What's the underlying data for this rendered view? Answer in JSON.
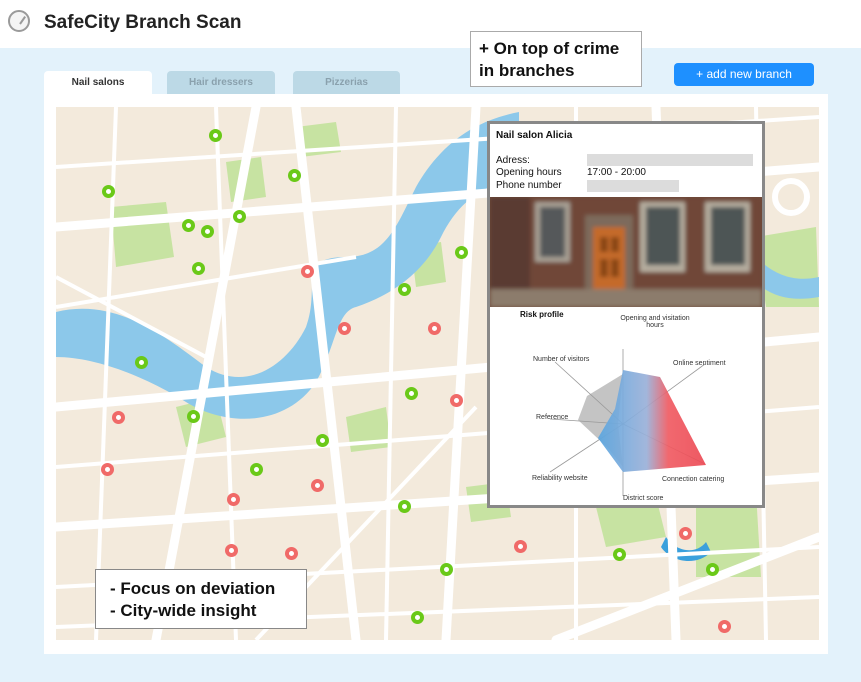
{
  "app": {
    "title": "SafeCity Branch Scan"
  },
  "tabs": [
    {
      "label": "Nail salons",
      "active": true
    },
    {
      "label": "Hair dressers",
      "active": false
    },
    {
      "label": "Pizzerias",
      "active": false
    }
  ],
  "annotations": {
    "top": [
      "+ On top of crime",
      "in branches"
    ],
    "bottom": [
      "- Focus on deviation",
      "- City-wide insight"
    ]
  },
  "toolbar": {
    "add_branch_label": "+ add new branch"
  },
  "branch_card": {
    "name": "Nail salon Alicia",
    "fields": [
      {
        "label": "Adress:",
        "value": ""
      },
      {
        "label": "Opening hours",
        "value": "17:00 - 20:00"
      },
      {
        "label": "Phone number",
        "value": ""
      }
    ],
    "risk_profile": {
      "title": "Risk profile",
      "axes": [
        "Opening and visitation hours",
        "Online sentiment",
        "Connection catering",
        "District score",
        "Reliability website",
        "Reference",
        "Number of visitors"
      ]
    }
  },
  "map": {
    "status_colors": {
      "ok": "#6ac918",
      "risk": "#f06a68"
    },
    "pins": [
      {
        "status": "ok"
      },
      {
        "status": "ok"
      },
      {
        "status": "ok"
      },
      {
        "status": "ok"
      },
      {
        "status": "ok"
      },
      {
        "status": "ok"
      },
      {
        "status": "ok"
      },
      {
        "status": "ok"
      },
      {
        "status": "ok"
      },
      {
        "status": "ok"
      },
      {
        "status": "ok"
      },
      {
        "status": "ok"
      },
      {
        "status": "ok"
      },
      {
        "status": "ok"
      },
      {
        "status": "ok"
      },
      {
        "status": "ok"
      },
      {
        "status": "ok"
      },
      {
        "status": "ok"
      },
      {
        "status": "ok"
      },
      {
        "status": "risk"
      },
      {
        "status": "risk"
      },
      {
        "status": "risk"
      },
      {
        "status": "risk"
      },
      {
        "status": "risk"
      },
      {
        "status": "risk"
      },
      {
        "status": "risk"
      },
      {
        "status": "risk"
      },
      {
        "status": "risk"
      },
      {
        "status": "risk"
      },
      {
        "status": "risk"
      },
      {
        "status": "risk"
      },
      {
        "status": "risk"
      }
    ]
  },
  "colors": {
    "accent": "#1e90ff",
    "panel": "#e3f2fb",
    "water": "#8cc8ea",
    "park": "#c7e3a2"
  }
}
